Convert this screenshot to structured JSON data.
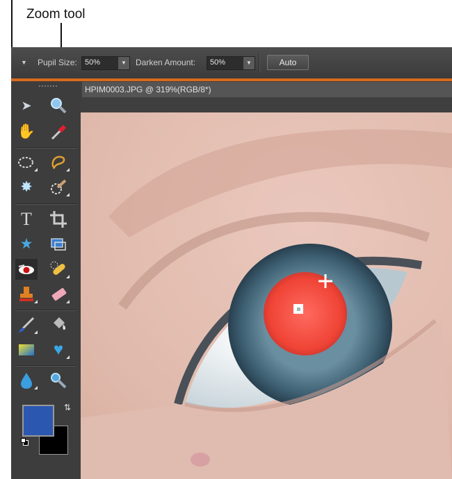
{
  "callout": {
    "label": "Zoom tool"
  },
  "options_bar": {
    "pupil_size_label": "Pupil Size:",
    "pupil_size_value": "50%",
    "darken_amount_label": "Darken Amount:",
    "darken_amount_value": "50%",
    "auto_button": "Auto"
  },
  "document": {
    "tab_title": "HPIM0003.JPG @ 319%(RGB/8*)"
  },
  "toolbox": {
    "tools": [
      "move-tool",
      "zoom-tool",
      "hand-tool",
      "eyedropper-tool",
      "marquee-tool",
      "lasso-tool",
      "magic-wand-tool",
      "quick-selection-tool",
      "type-tool",
      "crop-tool",
      "custom-shape-tool",
      "cookie-cutter-tool",
      "red-eye-removal-tool",
      "spot-healing-tool",
      "clone-stamp-tool",
      "eraser-tool",
      "brush-tool",
      "paint-bucket-tool",
      "gradient-tool",
      "shape-tool",
      "blur-tool",
      "sponge-tool"
    ],
    "text_tool_glyph": "T"
  },
  "colors": {
    "foreground": "#2b57b0",
    "background": "#000000",
    "accent": "#d86a1d"
  }
}
